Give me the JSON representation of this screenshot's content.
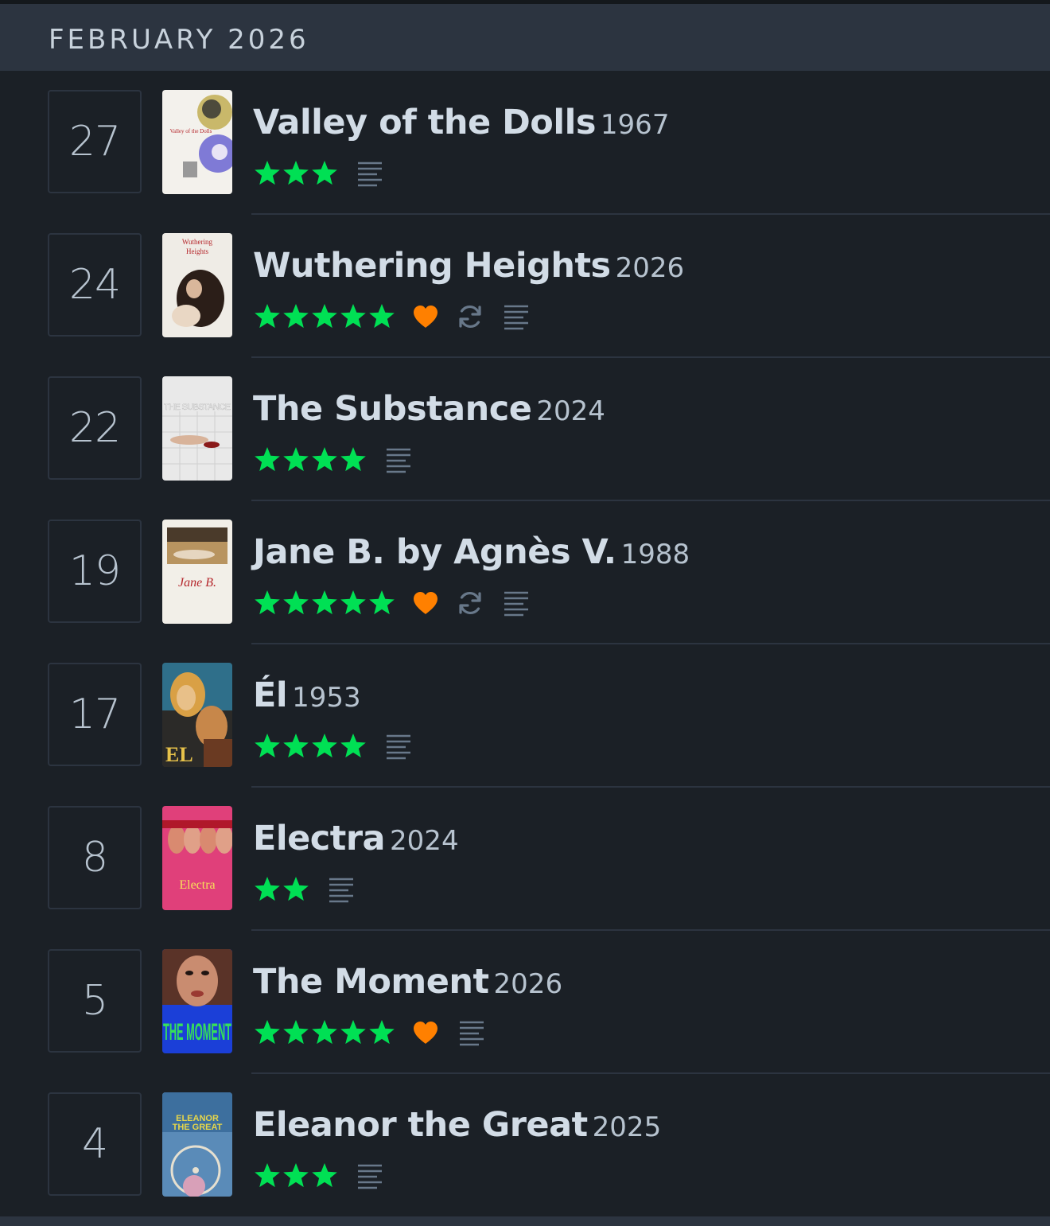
{
  "month": {
    "title": "FEBRUARY 2026"
  },
  "colors": {
    "star": "#00e054",
    "like": "#ff8000",
    "icon": "#68788a"
  },
  "entries": [
    {
      "day": "27",
      "title": "Valley of the Dolls",
      "year": "1967",
      "rating": 3,
      "liked": false,
      "rewatch": false,
      "review": true,
      "poster": "valley-of-the-dolls-poster"
    },
    {
      "day": "24",
      "title": "Wuthering Heights",
      "year": "2026",
      "rating": 5,
      "liked": true,
      "rewatch": true,
      "review": true,
      "poster": "wuthering-heights-poster"
    },
    {
      "day": "22",
      "title": "The Substance",
      "year": "2024",
      "rating": 4,
      "liked": false,
      "rewatch": false,
      "review": true,
      "poster": "the-substance-poster"
    },
    {
      "day": "19",
      "title": "Jane B. by Agnès V.",
      "year": "1988",
      "rating": 5,
      "liked": true,
      "rewatch": true,
      "review": true,
      "poster": "jane-b-poster"
    },
    {
      "day": "17",
      "title": "Él",
      "year": "1953",
      "rating": 4,
      "liked": false,
      "rewatch": false,
      "review": true,
      "poster": "el-poster"
    },
    {
      "day": "8",
      "title": "Electra",
      "year": "2024",
      "rating": 2,
      "liked": false,
      "rewatch": false,
      "review": true,
      "poster": "electra-poster"
    },
    {
      "day": "5",
      "title": "The Moment",
      "year": "2026",
      "rating": 5,
      "liked": true,
      "rewatch": false,
      "review": true,
      "poster": "the-moment-poster"
    },
    {
      "day": "4",
      "title": "Eleanor the Great",
      "year": "2025",
      "rating": 3,
      "liked": false,
      "rewatch": false,
      "review": true,
      "poster": "eleanor-the-great-poster"
    }
  ],
  "poster_text": {
    "valley": "Valley of the Dolls",
    "wuthering": [
      "Wuthering",
      "Heights"
    ],
    "substance": "THE SUBSTANCE",
    "jane": "Jane B.",
    "el": "EL",
    "electra": "Electra",
    "moment": "THE MOMENT",
    "eleanor": [
      "ELEANOR",
      "THE GREAT"
    ]
  }
}
